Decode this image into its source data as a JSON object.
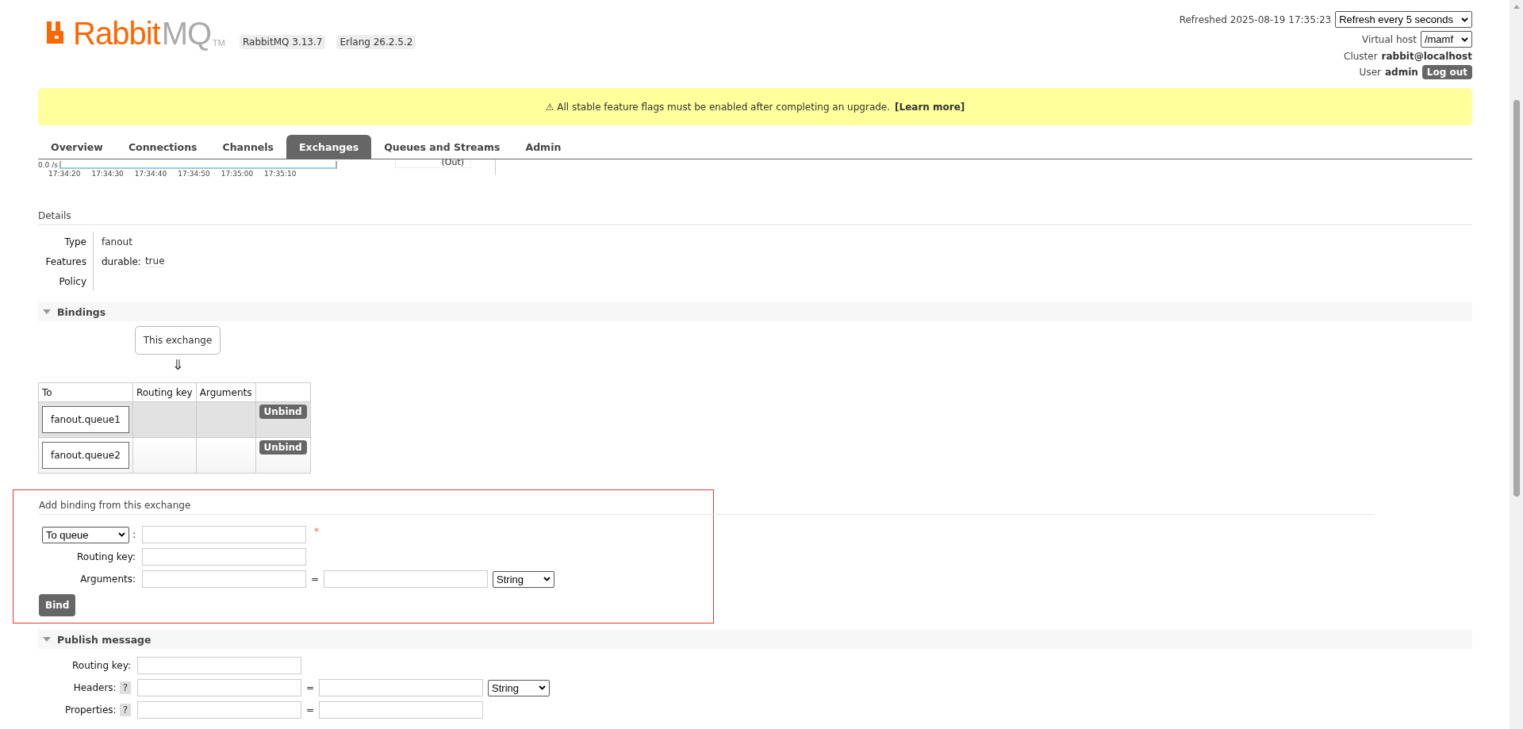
{
  "header": {
    "logo": {
      "main": "Rabbit",
      "accent": "MQ",
      "trademark": "TM"
    },
    "badges": [
      "RabbitMQ 3.13.7",
      "Erlang 26.2.5.2"
    ],
    "refreshed": "Refreshed 2025-08-19 17:35:23",
    "refresh_select": "Refresh every 5 seconds",
    "vhost_label": "Virtual host",
    "vhost_select": "/mamf",
    "cluster_label": "Cluster",
    "cluster": "rabbit@localhost",
    "user_label": "User",
    "user": "admin",
    "logout": "Log out"
  },
  "banner": {
    "message": "⚠ All stable feature flags must be enabled after completing an upgrade.",
    "link": "[Learn more]"
  },
  "tabs": [
    {
      "label": "Overview",
      "selected": false
    },
    {
      "label": "Connections",
      "selected": false
    },
    {
      "label": "Channels",
      "selected": false
    },
    {
      "label": "Exchanges",
      "selected": true
    },
    {
      "label": "Queues and Streams",
      "selected": false
    },
    {
      "label": "Admin",
      "selected": false
    }
  ],
  "rate_chart": {
    "y_label": "0.0 /s",
    "x_labels": [
      "17:34:20",
      "17:34:30",
      "17:34:40",
      "17:34:50",
      "17:35:00",
      "17:35:10"
    ],
    "legend": "(Out)"
  },
  "details": {
    "title": "Details",
    "rows": [
      {
        "kind": "text",
        "label": "Type",
        "value": "fanout"
      },
      {
        "kind": "feature",
        "label": "Features",
        "key": "durable:",
        "value": "true"
      },
      {
        "kind": "empty",
        "label": "Policy"
      }
    ]
  },
  "bindings": {
    "title": "Bindings",
    "expanded": true,
    "source": "This exchange",
    "arrow": "⇓",
    "columns": [
      "To",
      "Routing key",
      "Arguments"
    ],
    "rows": [
      {
        "to": "fanout.queue1",
        "action": "Unbind",
        "highlighted": true
      },
      {
        "to": "fanout.queue2",
        "action": "Unbind",
        "highlighted": false
      }
    ]
  },
  "add_binding": {
    "title": "Add binding from this exchange",
    "outlined": true,
    "destination_select": "To queue",
    "colon": ":",
    "required_mark": "*",
    "routing_key_label": "Routing key:",
    "arguments_label": "Arguments:",
    "equals": "=",
    "type_select": "String",
    "button": "Bind"
  },
  "publish": {
    "title": "Publish message",
    "expanded": true,
    "routing_key_label": "Routing key:",
    "headers_label": "Headers:",
    "help": "?",
    "equals": "=",
    "type_select": "String",
    "properties_label": "Properties:"
  }
}
